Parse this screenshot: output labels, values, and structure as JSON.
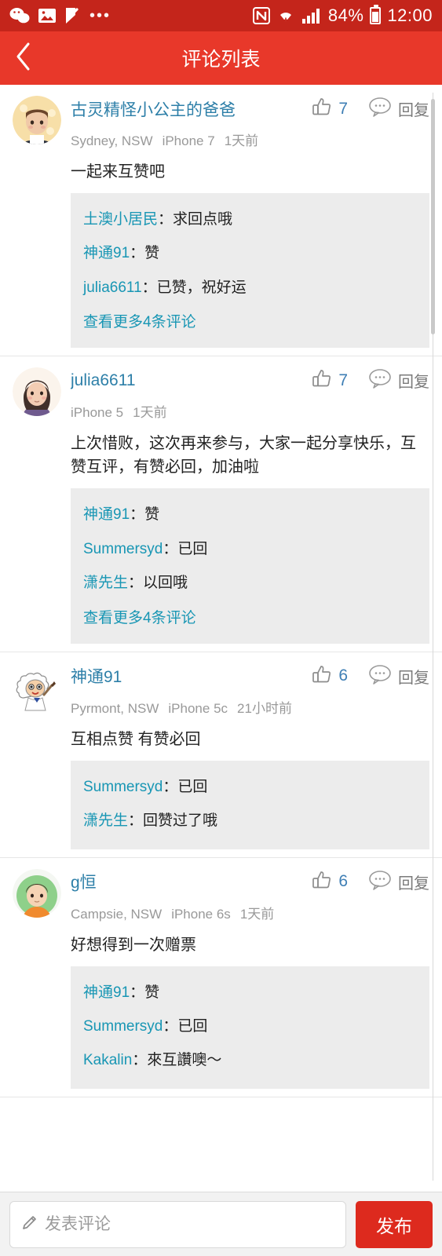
{
  "statusbar": {
    "left_icons": [
      "wechat-icon",
      "photo-icon",
      "checkmark-flag-icon",
      "more-dots-icon"
    ],
    "nfc_label": "N",
    "battery_percent": "84%",
    "clock": "12:00",
    "bg_color": "#c4251b"
  },
  "header": {
    "title": "评论列表",
    "back_icon": "chevron-left-icon",
    "bg_color": "#e8382a"
  },
  "theme": {
    "accent_red": "#dd2a1e",
    "link_blue": "#1896b4",
    "name_blue": "#2d7fa8",
    "reply_bg": "#ececec"
  },
  "comments": [
    {
      "username": "古灵精怪小公主的爸爸",
      "avatar": "avatar-girl-photo",
      "location": "Sydney, NSW",
      "device": "iPhone 7",
      "time": "1天前",
      "like_count": "7",
      "reply_label": "回复",
      "text": "一起来互赞吧",
      "replies": [
        {
          "user": "土澳小居民",
          "sep": "：",
          "text": "求回点哦"
        },
        {
          "user": "神通91",
          "sep": "：",
          "text": "赞"
        },
        {
          "user": "julia6611",
          "sep": "：",
          "text": "已赞，祝好运"
        }
      ],
      "more_link": "查看更多4条评论"
    },
    {
      "username": "julia6611",
      "avatar": "avatar-woman-cartoon",
      "location": "",
      "device": "iPhone 5",
      "time": "1天前",
      "like_count": "7",
      "reply_label": "回复",
      "text": "上次惜败，这次再来参与，大家一起分享快乐，互赞互评，有赞必回，加油啦",
      "replies": [
        {
          "user": "神通91",
          "sep": "：",
          "text": "赞"
        },
        {
          "user": "Summersyd",
          "sep": "：",
          "text": "已回"
        },
        {
          "user": "潇先生",
          "sep": "：",
          "text": "以回哦"
        }
      ],
      "more_link": "查看更多4条评论"
    },
    {
      "username": "神通91",
      "avatar": "avatar-sheep-cartoon",
      "location": "Pyrmont, NSW",
      "device": "iPhone 5c",
      "time": "21小时前",
      "like_count": "6",
      "reply_label": "回复",
      "text": "互相点赞 有赞必回",
      "replies": [
        {
          "user": "Summersyd",
          "sep": "：",
          "text": "已回"
        },
        {
          "user": "潇先生",
          "sep": "：",
          "text": "回赞过了哦"
        }
      ],
      "more_link": ""
    },
    {
      "username": "g恒",
      "avatar": "avatar-boy-cartoon",
      "location": "Campsie, NSW",
      "device": "iPhone 6s",
      "time": "1天前",
      "like_count": "6",
      "reply_label": "回复",
      "text": "好想得到一次赠票",
      "replies": [
        {
          "user": "神通91",
          "sep": "：",
          "text": "赞"
        },
        {
          "user": "Summersyd",
          "sep": "：",
          "text": "已回"
        },
        {
          "user": "Kakalin",
          "sep": "：",
          "text": "來互讚噢～"
        }
      ],
      "more_link": ""
    }
  ],
  "bottombar": {
    "input_value": "",
    "input_placeholder": "发表评论",
    "pencil_icon": "pencil-icon",
    "post_label": "发布"
  }
}
